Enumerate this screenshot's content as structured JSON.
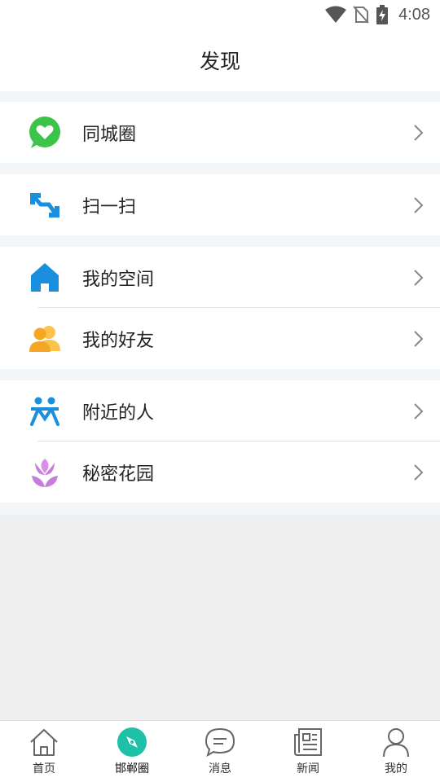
{
  "status_bar": {
    "time": "4:08"
  },
  "header": {
    "title": "发现"
  },
  "menu": {
    "groups": [
      {
        "items": [
          {
            "label": "同城圈",
            "icon": "chat-heart-icon",
            "color": "#3cc34a"
          }
        ]
      },
      {
        "items": [
          {
            "label": "扫一扫",
            "icon": "scan-icon",
            "color": "#1a8fe0"
          }
        ]
      },
      {
        "items": [
          {
            "label": "我的空间",
            "icon": "home-icon",
            "color": "#1a8fe0"
          },
          {
            "label": "我的好友",
            "icon": "friends-icon",
            "color": "#f5a623"
          }
        ]
      },
      {
        "items": [
          {
            "label": "附近的人",
            "icon": "people-nearby-icon",
            "color": "#1a8fe0"
          },
          {
            "label": "秘密花园",
            "icon": "flower-icon",
            "color": "#c77ddb"
          }
        ]
      }
    ]
  },
  "tabs": [
    {
      "label": "首页",
      "icon": "home-outline-icon"
    },
    {
      "label": "邯郸圈",
      "icon": "compass-icon",
      "active": true,
      "color": "#1ec0a8"
    },
    {
      "label": "消息",
      "icon": "message-icon"
    },
    {
      "label": "新闻",
      "icon": "news-icon"
    },
    {
      "label": "我的",
      "icon": "user-icon"
    }
  ]
}
